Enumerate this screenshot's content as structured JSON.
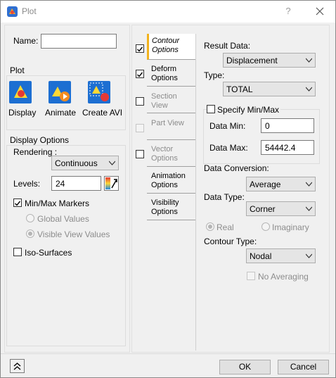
{
  "window": {
    "title": "Plot",
    "help_label": "?",
    "close_label": "✕"
  },
  "name": {
    "label": "Name:",
    "value": ""
  },
  "plot_group": {
    "label": "Plot",
    "display_label": "Display",
    "animate_label": "Animate",
    "create_avi_label": "Create AVI"
  },
  "display_options": {
    "label": "Display Options",
    "rendering_label": "Rendering :",
    "rendering_value": "Continuous",
    "levels_label": "Levels:",
    "levels_value": "24",
    "minmax_label": "Min/Max Markers",
    "minmax_checked": true,
    "global_values_label": "Global Values",
    "visible_view_label": "Visible View Values",
    "iso_surfaces_label": "Iso-Surfaces"
  },
  "tabs": {
    "contour_l1": "Contour",
    "contour_l2": "Options",
    "deform_l1": "Deform",
    "deform_l2": "Options",
    "section_l1": "Section View",
    "part_l1": "Part View",
    "vector_l1": "Vector",
    "vector_l2": "Options",
    "animation_l1": "Animation",
    "animation_l2": "Options",
    "visibility_l1": "Visibility",
    "visibility_l2": "Options"
  },
  "contour": {
    "result_data_label": "Result Data:",
    "result_data_value": "Displacement",
    "type_label": "Type:",
    "type_value": "TOTAL",
    "specify_label": "Specify Min/Max",
    "data_min_label": "Data Min:",
    "data_min_value": "0",
    "data_max_label": "Data Max:",
    "data_max_value": "54442.4",
    "data_conversion_label": "Data Conversion:",
    "data_conversion_value": "Average",
    "data_type_label": "Data Type:",
    "data_type_value": "Corner",
    "real_label": "Real",
    "imaginary_label": "Imaginary",
    "contour_type_label": "Contour Type:",
    "contour_type_value": "Nodal",
    "no_averaging_label": "No Averaging"
  },
  "footer": {
    "ok_label": "OK",
    "cancel_label": "Cancel"
  },
  "colors": {
    "accent_tab": "#f2b21c",
    "window_bg": "#f0f0f0"
  }
}
